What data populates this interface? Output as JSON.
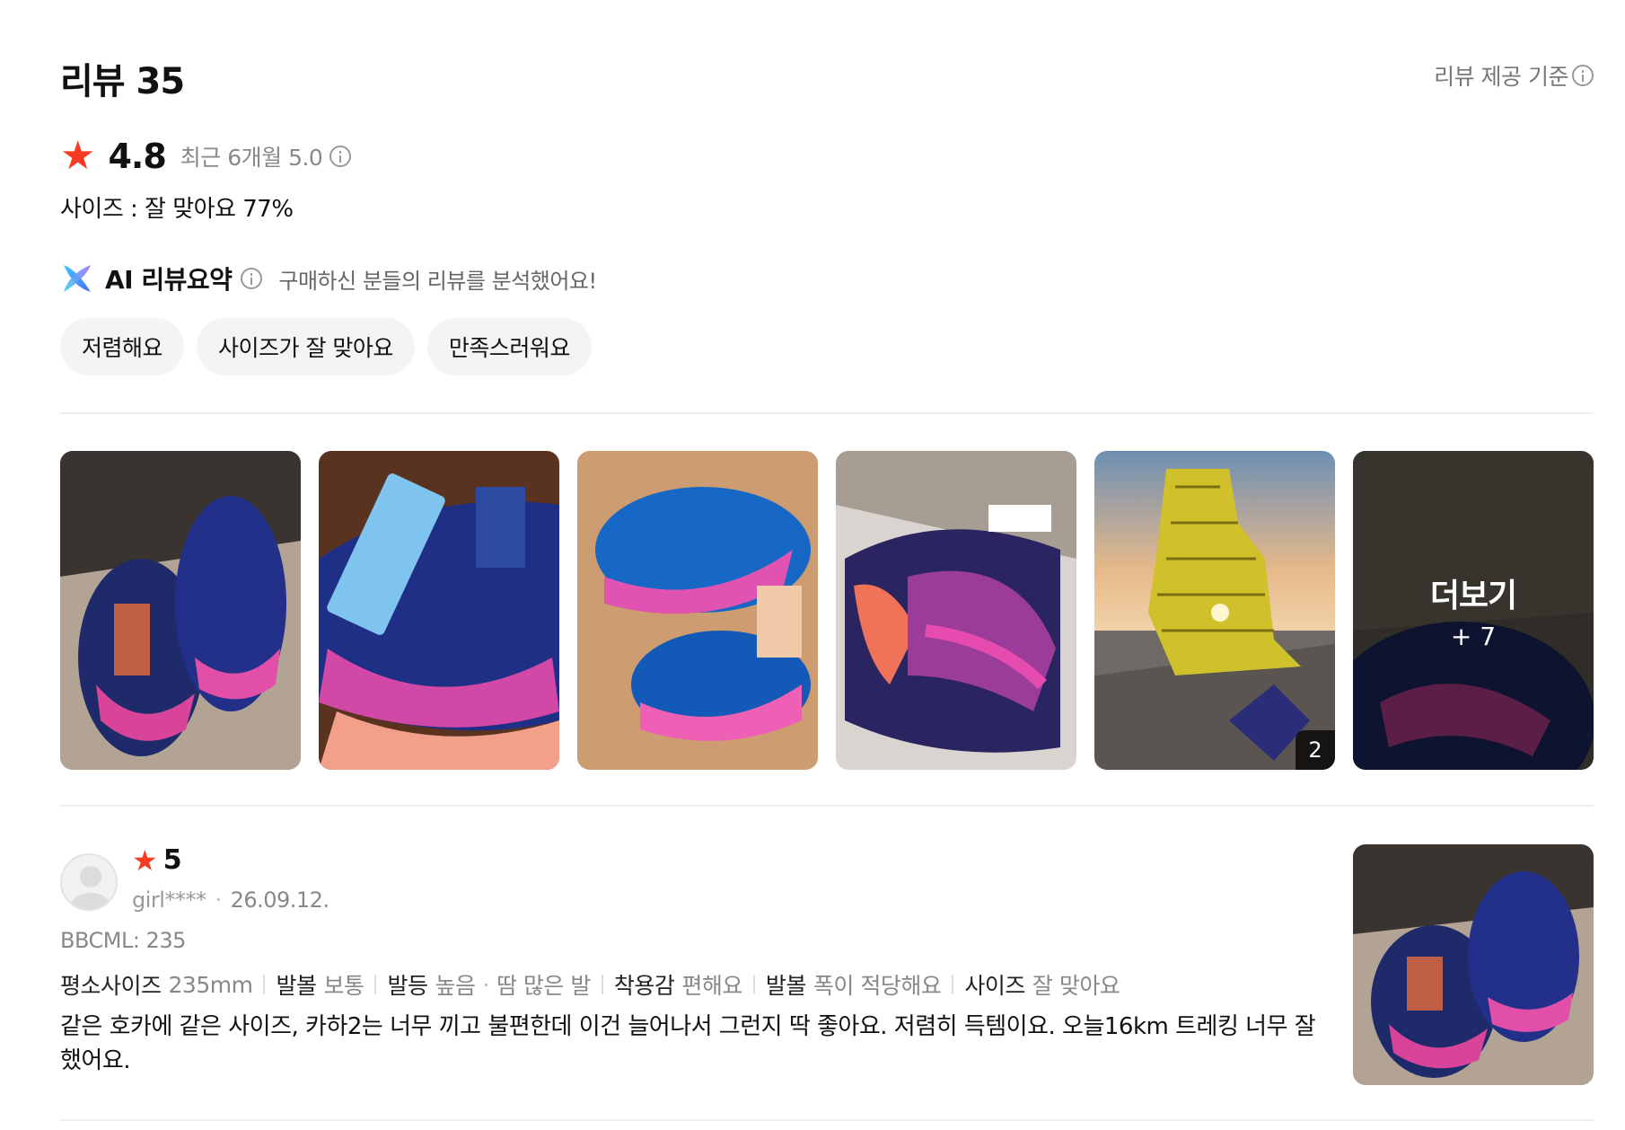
{
  "header": {
    "title": "리뷰 35",
    "criteria_label": "리뷰 제공 기준"
  },
  "rating": {
    "average": "4.8",
    "recent_label": "최근 6개월 5.0"
  },
  "size_summary": "사이즈 : 잘 맞아요 77%",
  "ai_summary": {
    "title": "AI 리뷰요약",
    "description": "구매하신 분들의 리뷰를 분석했어요!",
    "chips": [
      "저렴해요",
      "사이즈가 잘 맞아요",
      "만족스러워요"
    ]
  },
  "gallery": {
    "photo5_count": "2",
    "more_label": "더보기",
    "more_count": "+ 7"
  },
  "review": {
    "star": "★",
    "score": "5",
    "author": "girl****",
    "date": "26.09.12.",
    "option": "BBCML: 235",
    "attributes": [
      {
        "key": "평소사이즈",
        "value": "235mm"
      },
      {
        "key": "발볼",
        "value": "보통"
      },
      {
        "key": "발등",
        "value": "높음"
      },
      {
        "key": "",
        "value": "땀 많은 발"
      },
      {
        "key": "착용감",
        "value": "편해요"
      },
      {
        "key": "발볼",
        "value": "폭이 적당해요"
      },
      {
        "key": "사이즈",
        "value": "잘 맞아요"
      }
    ],
    "text": "같은 호카에 같은 사이즈, 카하2는 너무 끼고 불편한데 이건 늘어나서 그런지 딱 좋아요. 저렴히 득템이요. 오늘16km 트레킹 너무 잘 했어요."
  },
  "colors": {
    "star": "#f53b24",
    "chip_bg": "#f3f4f5",
    "divider": "#eeeeee"
  }
}
